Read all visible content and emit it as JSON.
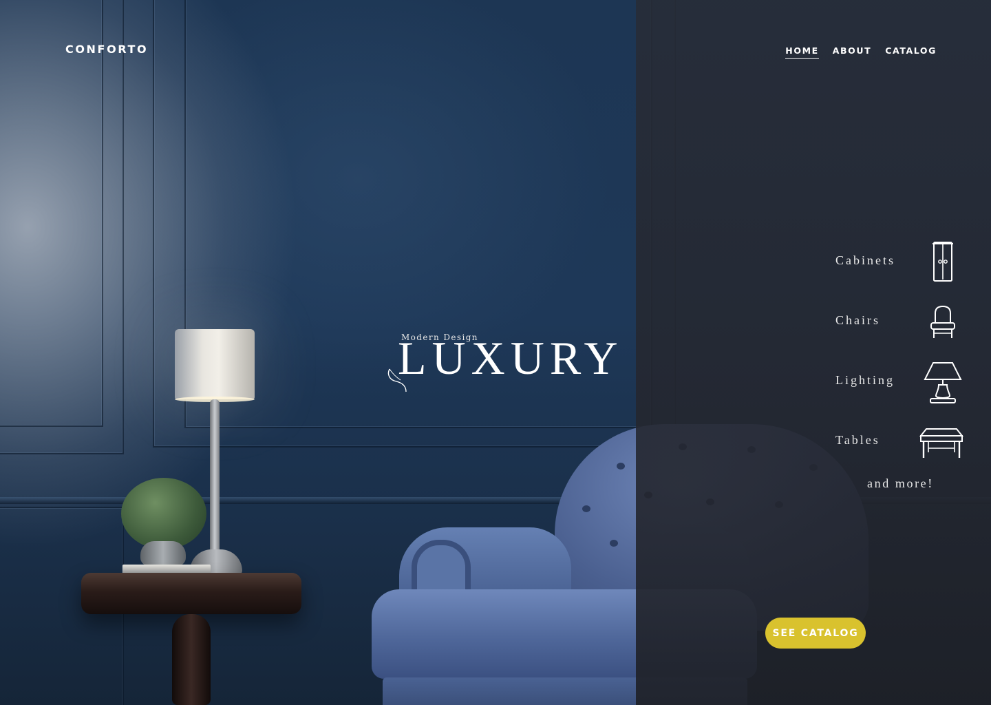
{
  "brand": {
    "name": "CONFORTO"
  },
  "nav": {
    "items": [
      {
        "label": "HOME",
        "active": true
      },
      {
        "label": "ABOUT",
        "active": false
      },
      {
        "label": "CATALOG",
        "active": false
      }
    ]
  },
  "hero": {
    "eyebrow": "Modern Design",
    "headline": "LUXURY"
  },
  "categories": {
    "items": [
      {
        "label": "Cabinets",
        "icon": "cabinet-icon"
      },
      {
        "label": "Chairs",
        "icon": "chair-icon"
      },
      {
        "label": "Lighting",
        "icon": "lamp-icon"
      },
      {
        "label": "Tables",
        "icon": "table-icon"
      }
    ],
    "more_label": "and more!"
  },
  "cta": {
    "label": "SEE CATALOG",
    "color": "#d9c22e"
  },
  "colors": {
    "wall": "#1d3654",
    "overlay": "#26282f",
    "armchair": "#5a74a6"
  }
}
